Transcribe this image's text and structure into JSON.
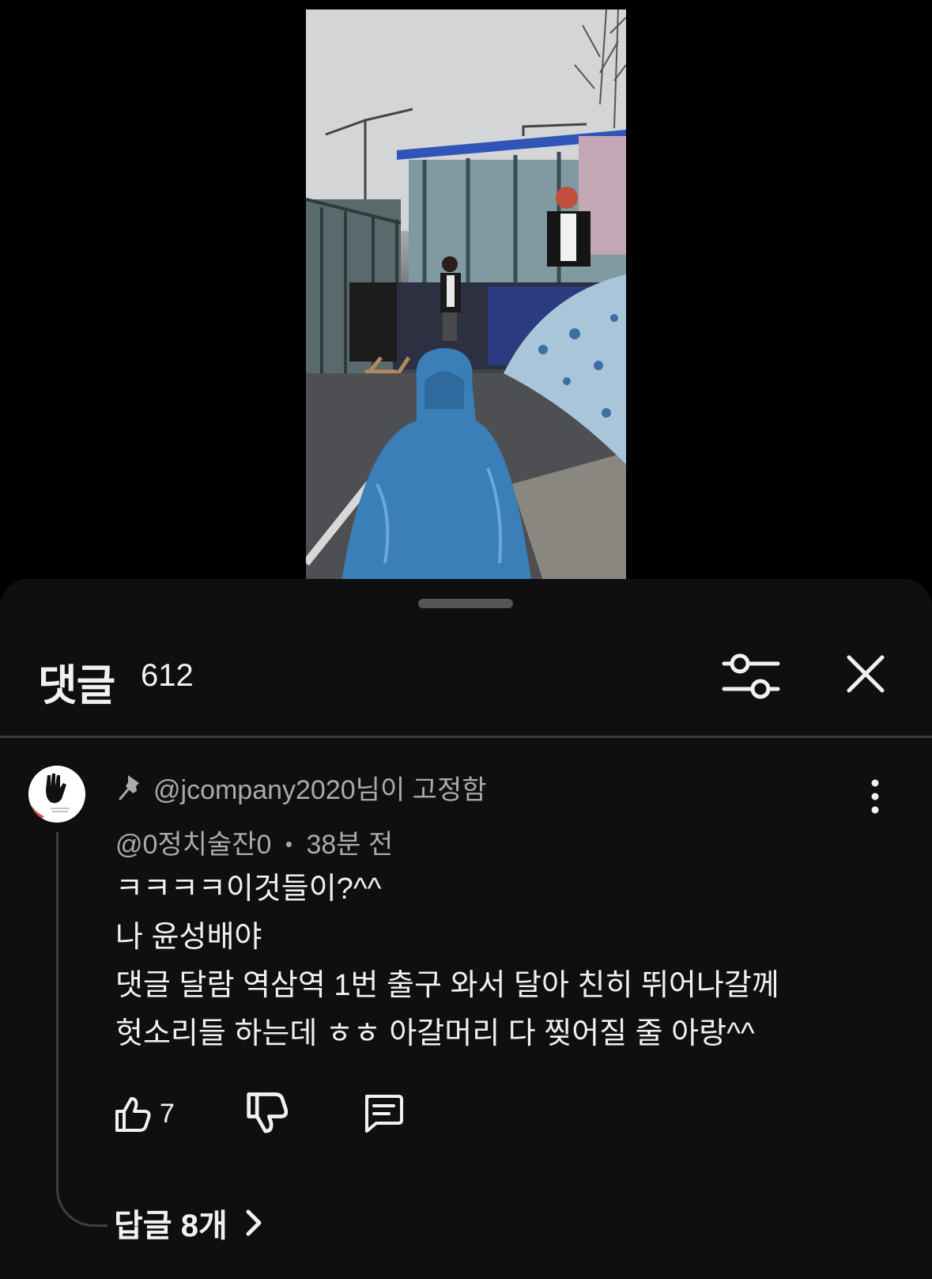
{
  "video": {
    "description_icon": "video-frame"
  },
  "comments_panel": {
    "title": "댓글",
    "count": "612",
    "filter_icon": "sliders-icon",
    "close_icon": "close-icon"
  },
  "comment": {
    "pinned_by": "@jcompany2020님이 고정함",
    "author": "@0정치술잔0",
    "separator": "•",
    "time_ago": "38분 전",
    "text": "ㅋㅋㅋㅋ이것들이?^^\n나 윤성배야\n댓글 달람 역삼역 1번 출구 와서 달아 친히 뛰어나갈께\n헛소리들 하는데 ㅎㅎ 아갈머리 다 찢어질 줄 아랑^^",
    "likes": "7",
    "replies_label": "답글 8개"
  },
  "colors": {
    "sheet_bg": "#0f0f0f",
    "primary_text": "#f1f1f1",
    "secondary_text": "#aaaaaa",
    "divider": "#3a3a3a"
  }
}
